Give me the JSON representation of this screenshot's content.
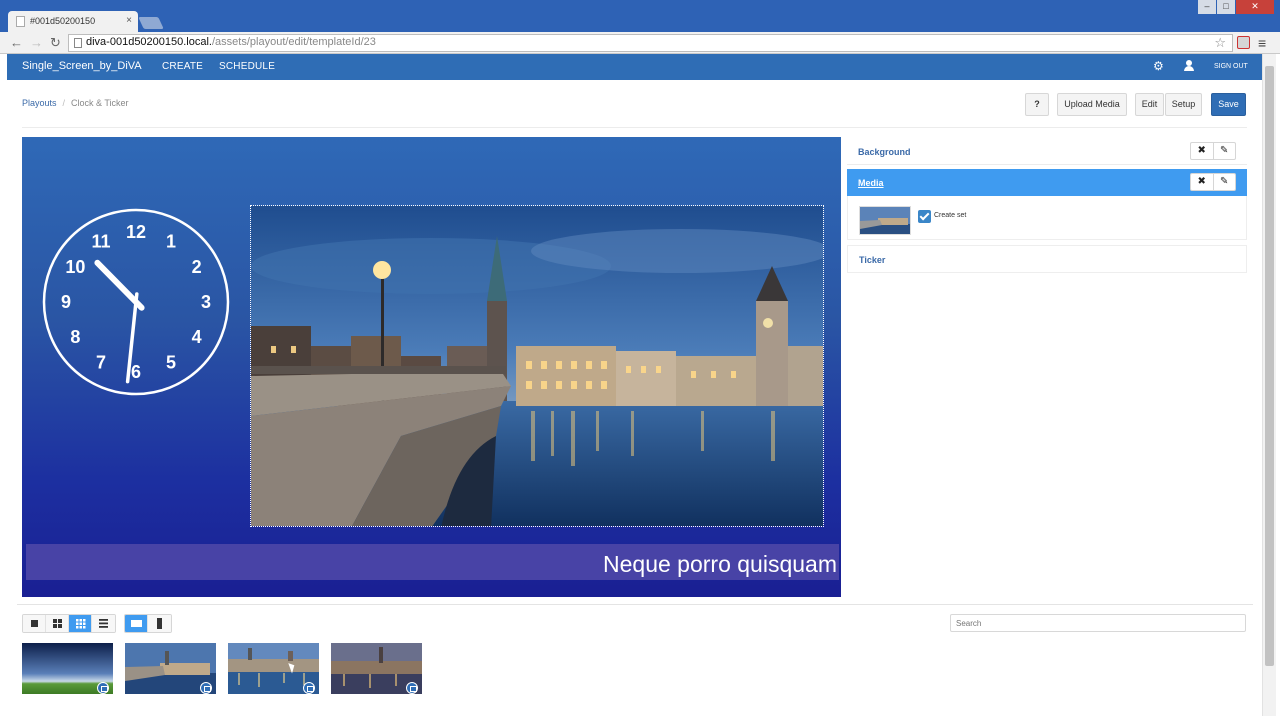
{
  "browser": {
    "tab_title": "#001d50200150",
    "tab_close": "×",
    "url_host": "diva-001d50200150.local.",
    "url_path": "/assets/playout/edit/templateId/23",
    "back_icon": "←",
    "forward_icon": "→",
    "reload_icon": "↻",
    "star_icon": "☆",
    "menu_icon": "≡",
    "window_buttons": [
      "–",
      "□",
      "✕"
    ]
  },
  "nav": {
    "brand": "Single_Screen_by_DiVA",
    "links": [
      "CREATE",
      "SCHEDULE"
    ],
    "gear_icon": "⚙",
    "signout": "SIGN OUT"
  },
  "breadcrumb": {
    "root": "Playouts",
    "separator": "/",
    "current": "Clock & Ticker"
  },
  "actions": {
    "help": "?",
    "upload": "Upload Media",
    "edit": "Edit",
    "setup": "Setup",
    "save": "Save"
  },
  "canvas": {
    "clock_numbers": [
      "12",
      "1",
      "2",
      "3",
      "4",
      "5",
      "6",
      "7",
      "8",
      "9",
      "10",
      "11"
    ],
    "clock_time": {
      "hours": 10,
      "minutes": 31
    },
    "ticker_text": "Neque porro quisquam"
  },
  "panel": {
    "background_label": "Background",
    "media_label": "Media",
    "ticker_label": "Ticker",
    "remove_icon": "✖",
    "edit_icon": "✎",
    "create_set_label": "Create set",
    "create_set_checked": true
  },
  "library": {
    "search_placeholder": "Search",
    "view_modes": [
      "single",
      "grid-4",
      "grid-9",
      "list"
    ],
    "active_view": "grid-9",
    "orientation_modes": [
      "landscape",
      "portrait"
    ],
    "active_orientation": "landscape",
    "items": [
      {
        "name": "sky-landscape-thumbnail"
      },
      {
        "name": "zurich-bridge-thumbnail"
      },
      {
        "name": "zurich-river-thumbnail"
      },
      {
        "name": "zurich-dusk-thumbnail"
      }
    ]
  },
  "colors": {
    "brand_blue": "#2f6db5",
    "active_blue": "#3f9bf0",
    "ticker_bg": "#4843a6"
  }
}
